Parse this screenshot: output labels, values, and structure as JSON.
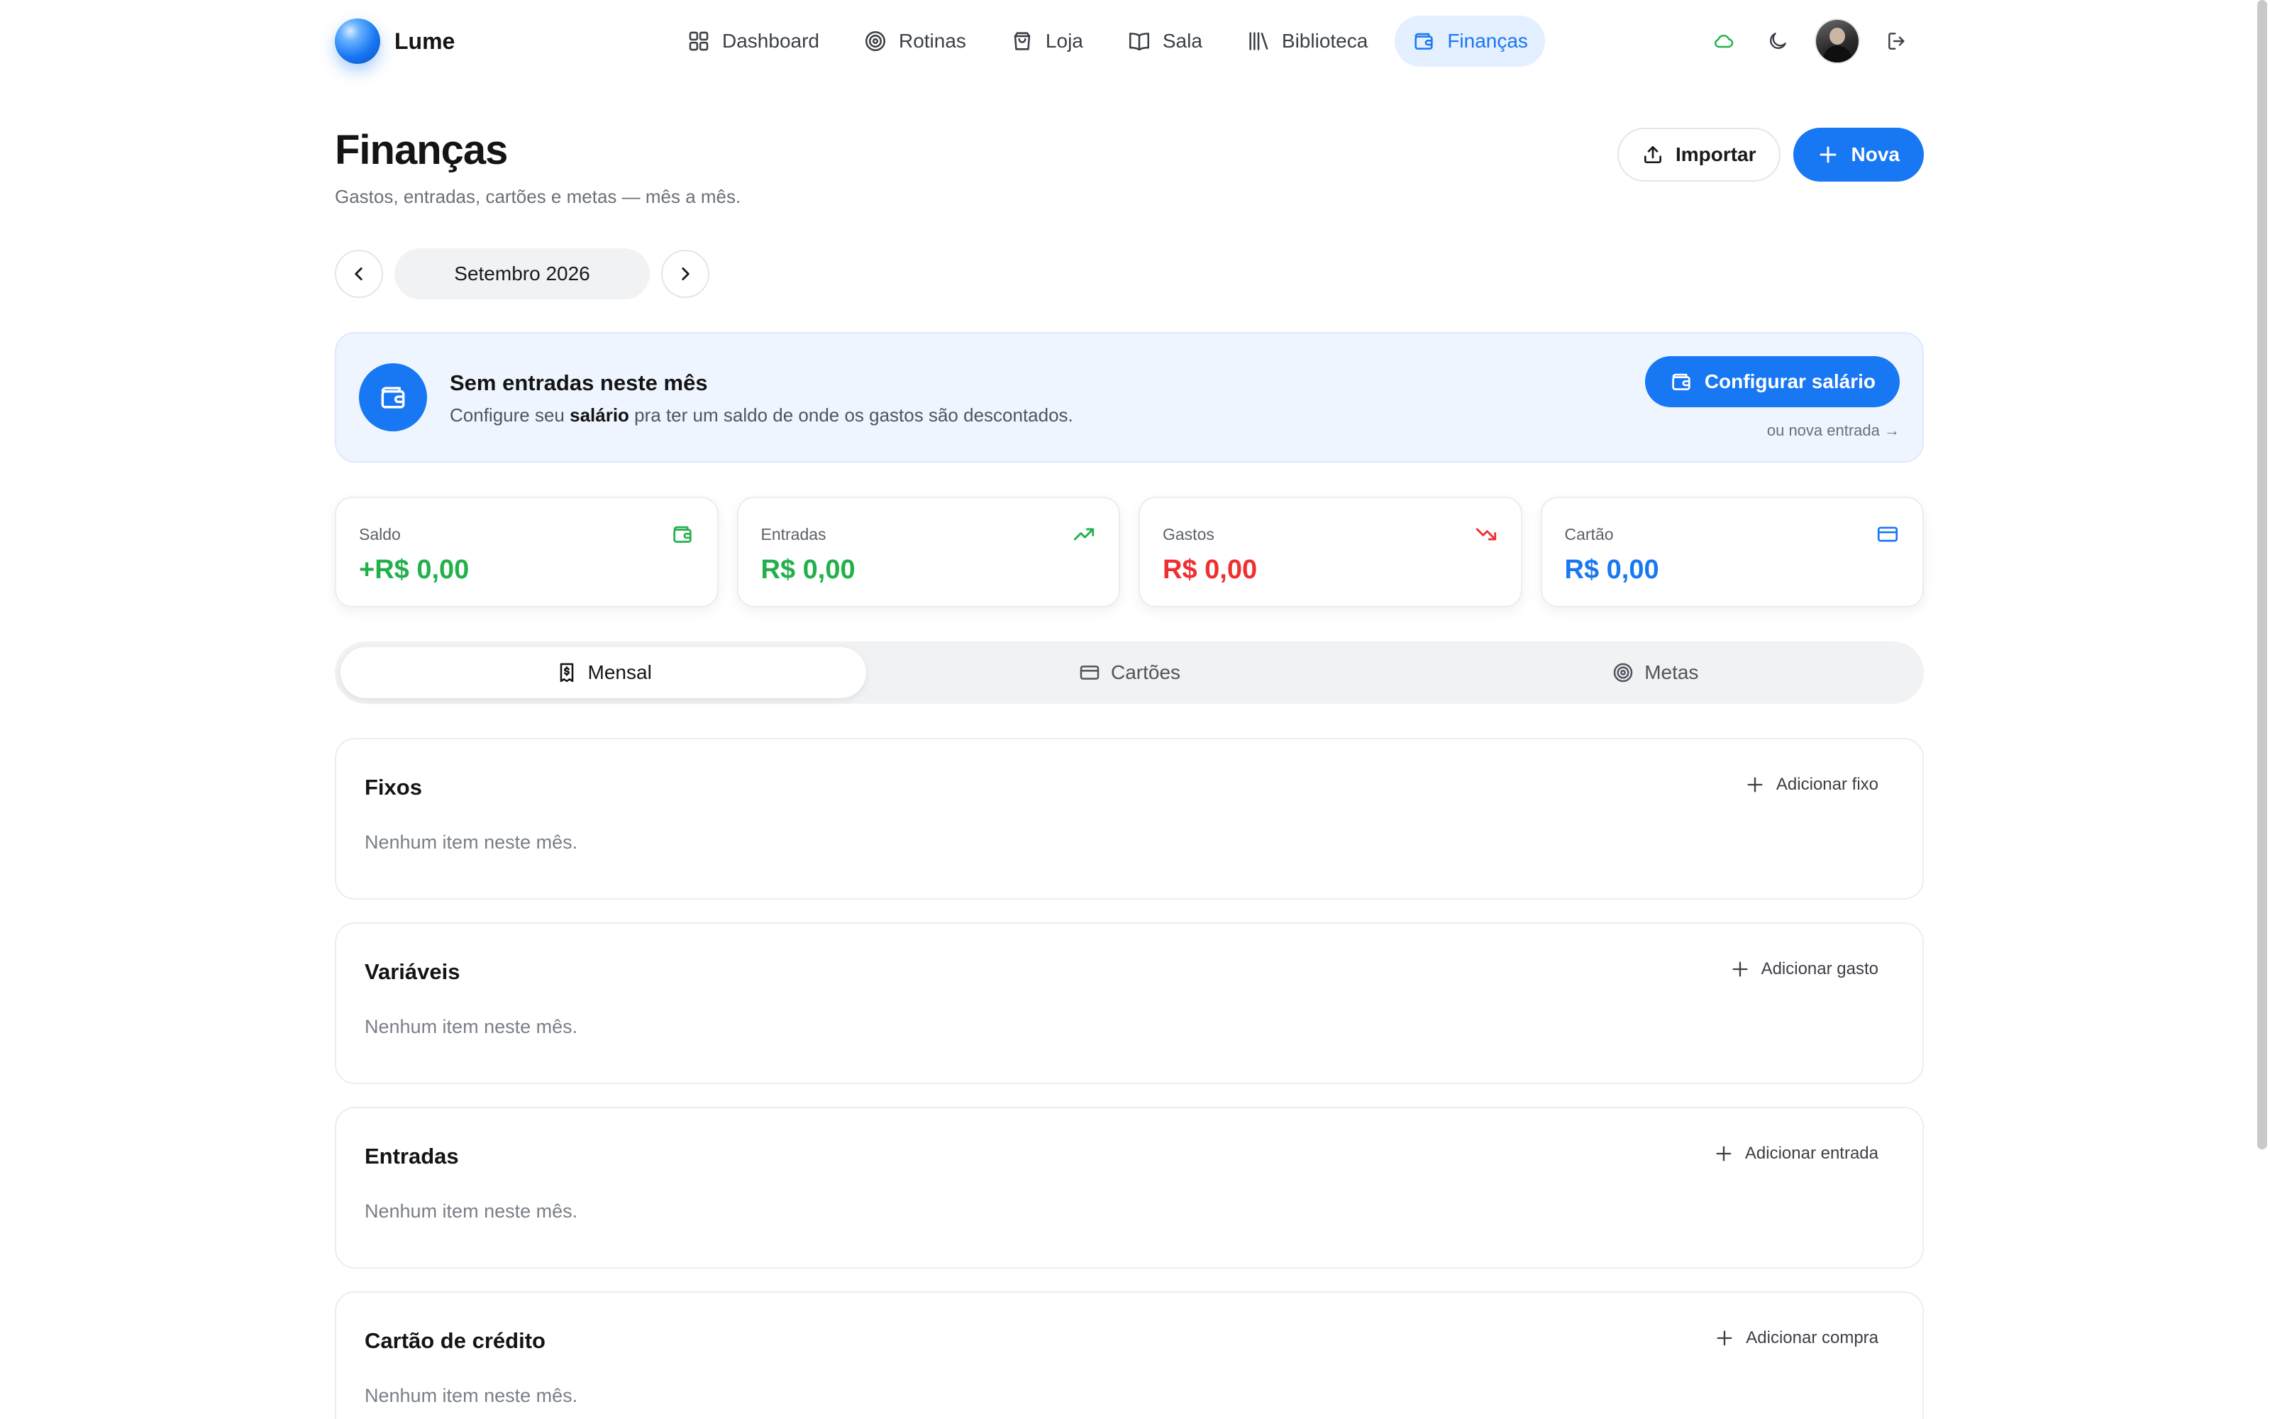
{
  "app": {
    "name": "Lume"
  },
  "nav": {
    "items": [
      {
        "label": "Dashboard",
        "icon": "grid-icon"
      },
      {
        "label": "Rotinas",
        "icon": "target-icon"
      },
      {
        "label": "Loja",
        "icon": "shopping-bag-icon"
      },
      {
        "label": "Sala",
        "icon": "book-open-icon"
      },
      {
        "label": "Biblioteca",
        "icon": "library-icon"
      },
      {
        "label": "Finanças",
        "icon": "wallet-icon",
        "active": true
      }
    ]
  },
  "topbar": {
    "actions": [
      "cloud-sync-icon",
      "moon-icon",
      "avatar",
      "logout-icon"
    ]
  },
  "header": {
    "title": "Finanças",
    "subtitle": "Gastos, entradas, cartões e metas — mês a mês.",
    "import_label": "Importar",
    "new_label": "Nova"
  },
  "month": {
    "label": "Setembro 2026"
  },
  "banner": {
    "title": "Sem entradas neste mês",
    "text_before": "Configure seu ",
    "text_bold": "salário",
    "text_after": " pra ter um saldo de onde os gastos são descontados.",
    "cta_label": "Configurar salário",
    "link_label": "ou nova entrada →"
  },
  "stats": [
    {
      "label": "Saldo",
      "value": "+R$ 0,00",
      "color": "#22b04b",
      "icon": "wallet-icon"
    },
    {
      "label": "Entradas",
      "value": "R$ 0,00",
      "color": "#22b04b",
      "icon": "trending-up-icon"
    },
    {
      "label": "Gastos",
      "value": "R$ 0,00",
      "color": "#ef2f2f",
      "icon": "trending-down-icon"
    },
    {
      "label": "Cartão",
      "value": "R$ 0,00",
      "color": "#1877f2",
      "icon": "credit-card-icon"
    }
  ],
  "tabs": [
    {
      "label": "Mensal",
      "icon": "receipt-icon",
      "active": true
    },
    {
      "label": "Cartões",
      "icon": "credit-card-icon"
    },
    {
      "label": "Metas",
      "icon": "target-icon"
    }
  ],
  "sections": [
    {
      "title": "Fixos",
      "add_label": "Adicionar fixo",
      "empty": "Nenhum item neste mês."
    },
    {
      "title": "Variáveis",
      "add_label": "Adicionar gasto",
      "empty": "Nenhum item neste mês."
    },
    {
      "title": "Entradas",
      "add_label": "Adicionar entrada",
      "empty": "Nenhum item neste mês."
    },
    {
      "title": "Cartão de crédito",
      "add_label": "Adicionar compra",
      "empty": "Nenhum item neste mês."
    }
  ],
  "colors": {
    "accent": "#1877f2",
    "positive": "#22b04b",
    "negative": "#ef2f2f"
  }
}
